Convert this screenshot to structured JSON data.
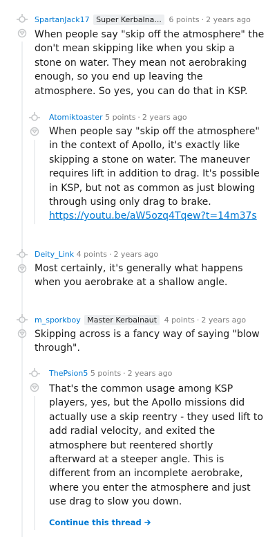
{
  "comments": [
    {
      "author": "SpartanJack17",
      "flair": "Super Kerbalna...",
      "points": "6 points",
      "age": "2 years ago",
      "body": "When people say \"skip off the atmosphere\" the\ndon't mean skipping like when you skip a\nstone on water. They mean not aerobraking\nenough, so you end up leaving the\natmosphere. So yes, you can do that in KSP."
    },
    {
      "author": "Atomiktoaster",
      "points": "5 points",
      "age": "2 years ago",
      "body": "When people say \"skip off the atmosphere\"\nin the context of Apollo, it's exactly like\nskipping a stone on water. The maneuver\nrequires lift in addition to drag. It's possible\nin KSP, but not as common as just blowing\nthrough using only drag to brake.",
      "link": "https://youtu.be/aW5ozq4Tqew?t=14m37s"
    },
    {
      "author": "Deity_Link",
      "points": "4 points",
      "age": "2 years ago",
      "body": "Most certainly, it's generally what happens\nwhen you aerobrake at a shallow angle."
    },
    {
      "author": "m_sporkboy",
      "flair": "Master Kerbalnaut",
      "points": "4 points",
      "age": "2 years ago",
      "body": "Skipping across is a fancy way of saying \"blow\nthrough\"."
    },
    {
      "author": "ThePsion5",
      "points": "5 points",
      "age": "2 years ago",
      "body": "That's the common usage among KSP\nplayers, yes, but the Apollo missions did\nactually use a skip reentry - they used lift to\nadd radial velocity, and exited the\natmosphere but reentered shortly\nafterward at a steeper angle. This is\ndifferent from an incomplete aerobrake,\nwhere you enter the atmosphere and just\nuse drag to slow you down."
    }
  ],
  "continue_thread": {
    "label": "Continue this thread",
    "icon": "arrow-right-icon"
  },
  "colors": {
    "author": "#0079d3",
    "meta": "#7c7c7c",
    "flair_bg": "#edeff1",
    "thread_line": "#edeff1",
    "icon": "#c4c6c8"
  }
}
